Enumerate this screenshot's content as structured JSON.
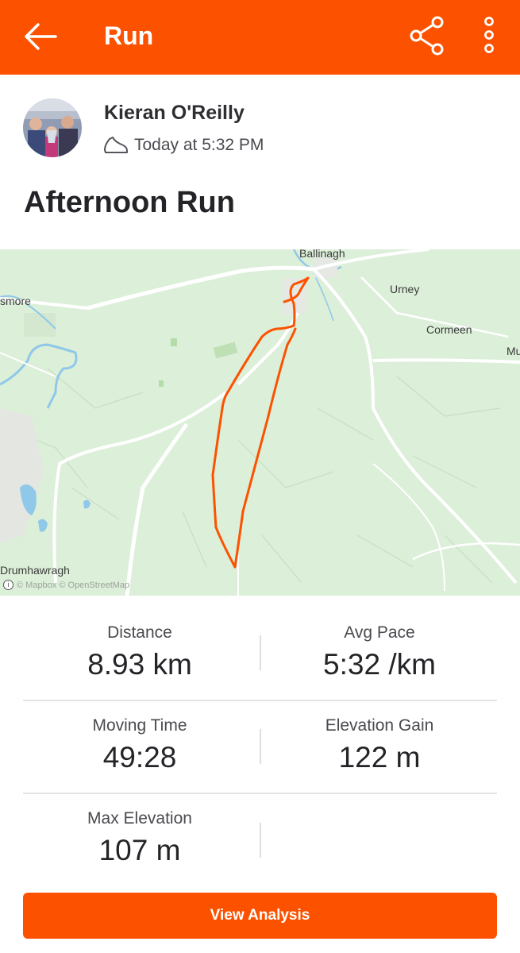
{
  "app_bar": {
    "title": "Run",
    "icons": [
      "back-arrow-icon",
      "share-icon",
      "more-vertical-icon"
    ]
  },
  "athlete": {
    "name": "Kieran O'Reilly",
    "date": "Today at 5:32 PM",
    "activity_icon": "running-shoe-icon"
  },
  "activity": {
    "name": "Afternoon Run"
  },
  "map": {
    "places": {
      "ballinagh": "Ballinagh",
      "urney": "Urney",
      "cormeen": "Cormeen",
      "smore": "smore",
      "mu": "Mu",
      "drumhawragh": "Drumhawragh"
    },
    "attribution": "© Mapbox © OpenStreetMap",
    "route_color": "#fc5200"
  },
  "stats": [
    {
      "label": "Distance",
      "value": "8.93 km"
    },
    {
      "label": "Avg Pace",
      "value": "5:32 /km"
    },
    {
      "label": "Moving Time",
      "value": "49:28"
    },
    {
      "label": "Elevation Gain",
      "value": "122 m"
    },
    {
      "label": "Max Elevation",
      "value": "107 m"
    }
  ],
  "actions": {
    "view_analysis": "View Analysis"
  },
  "colors": {
    "accent": "#fc5200",
    "map_land": "#dcefd9",
    "map_water": "#8fc8e8"
  }
}
